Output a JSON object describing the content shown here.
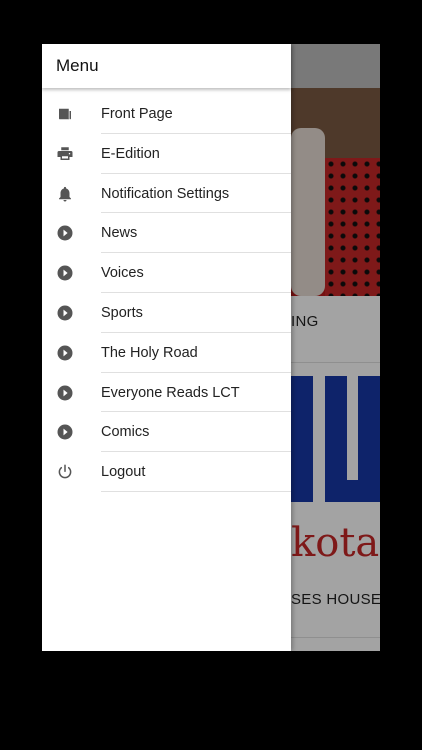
{
  "drawer": {
    "title": "Menu",
    "items": [
      {
        "label": "Front Page",
        "icon": "newspaper-icon"
      },
      {
        "label": "E-Edition",
        "icon": "printer-icon"
      },
      {
        "label": "Notification Settings",
        "icon": "bell-icon"
      },
      {
        "label": "News",
        "icon": "play-circle-icon"
      },
      {
        "label": "Voices",
        "icon": "play-circle-icon"
      },
      {
        "label": "Sports",
        "icon": "play-circle-icon"
      },
      {
        "label": "The Holy Road",
        "icon": "play-circle-icon"
      },
      {
        "label": "Everyone Reads LCT",
        "icon": "play-circle-icon"
      },
      {
        "label": "Comics",
        "icon": "play-circle-icon"
      },
      {
        "label": "Logout",
        "icon": "power-icon"
      }
    ]
  },
  "background": {
    "headline_1": "ING",
    "headline_2": "SES HOUSE",
    "script_text": "kota"
  },
  "colors": {
    "icon": "#555555",
    "accent_logo": "#1637a6",
    "script": "#c62828"
  }
}
